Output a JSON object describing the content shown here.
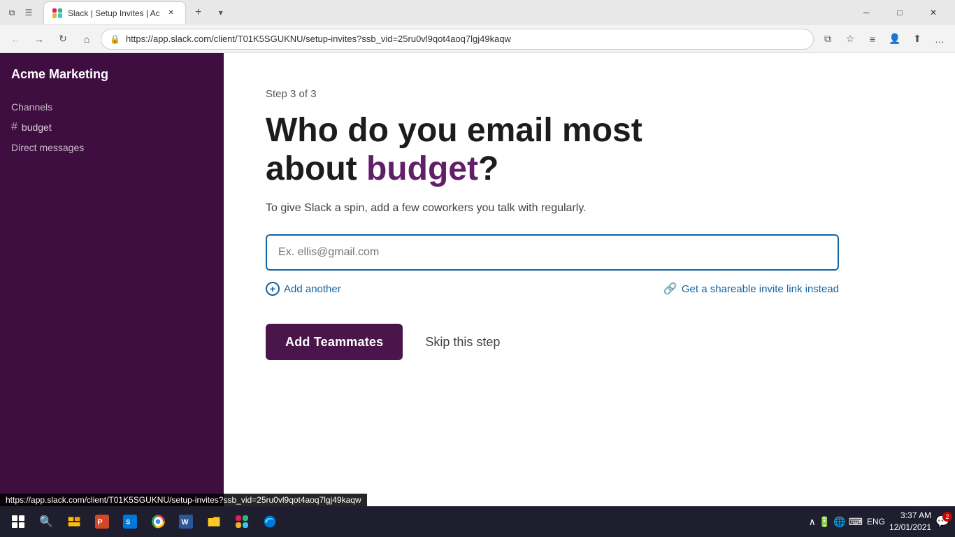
{
  "browser": {
    "tab_title": "Slack | Setup Invites | Ac",
    "url": "https://app.slack.com/client/T01K5SGUKNU/setup-invites?ssb_vid=25ru0vl9qot4aoq7lgj49kaqw",
    "nav": {
      "back": "←",
      "forward": "→",
      "refresh": "↻",
      "home": "⌂"
    },
    "win_buttons": {
      "minimize": "─",
      "maximize": "□",
      "close": "✕"
    }
  },
  "sidebar": {
    "workspace_name": "Acme Marketing",
    "channels_label": "Channels",
    "channels": [
      {
        "name": "budget",
        "hash": "#"
      }
    ],
    "dm_label": "Direct messages"
  },
  "main": {
    "step_label": "Step 3 of 3",
    "heading_part1": "Who do you email most",
    "heading_part2": "about ",
    "heading_highlight": "budget",
    "heading_part3": "?",
    "sub_text": "To give Slack a spin, add a few coworkers you talk with regularly.",
    "email_placeholder": "Ex. ellis@gmail.com",
    "add_another_label": "Add another",
    "invite_link_label": "Get a shareable invite link",
    "invite_link_suffix": " instead",
    "btn_add_teammates": "Add Teammates",
    "btn_skip": "Skip this step"
  },
  "status_bar": {
    "url": "https://app.slack.com/client/T01K5SGUKNU/setup-invites?ssb_vid=25ru0vl9qot4aoq7lgj49kaqw"
  },
  "taskbar": {
    "time": "3:37 AM",
    "date": "12/01/2021",
    "lang": "ENG",
    "notification_count": "2"
  }
}
